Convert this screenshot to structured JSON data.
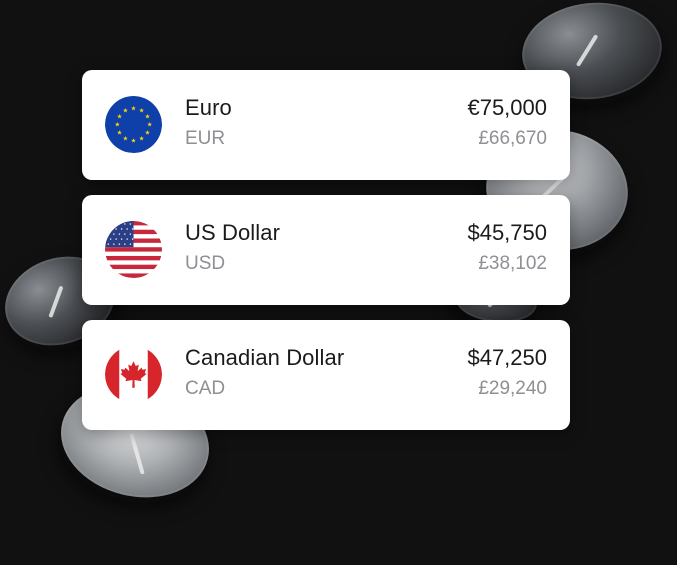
{
  "currencies": [
    {
      "name": "Euro",
      "code": "EUR",
      "amount": "€75,000",
      "converted": "£66,670",
      "flag_icon": "eu-flag-icon"
    },
    {
      "name": "US Dollar",
      "code": "USD",
      "amount": "$45,750",
      "converted": "£38,102",
      "flag_icon": "us-flag-icon"
    },
    {
      "name": "Canadian Dollar",
      "code": "CAD",
      "amount": "$47,250",
      "converted": "£29,240",
      "flag_icon": "ca-flag-icon"
    }
  ],
  "colors": {
    "background": "#111111",
    "card": "#ffffff",
    "primary_text": "#1b1b1d",
    "secondary_text": "#8f8f94",
    "eu_blue": "#0f3fa8",
    "eu_star": "#f7d317",
    "us_red": "#c8283c",
    "us_blue": "#2a3f86",
    "ca_red": "#d7262b"
  }
}
